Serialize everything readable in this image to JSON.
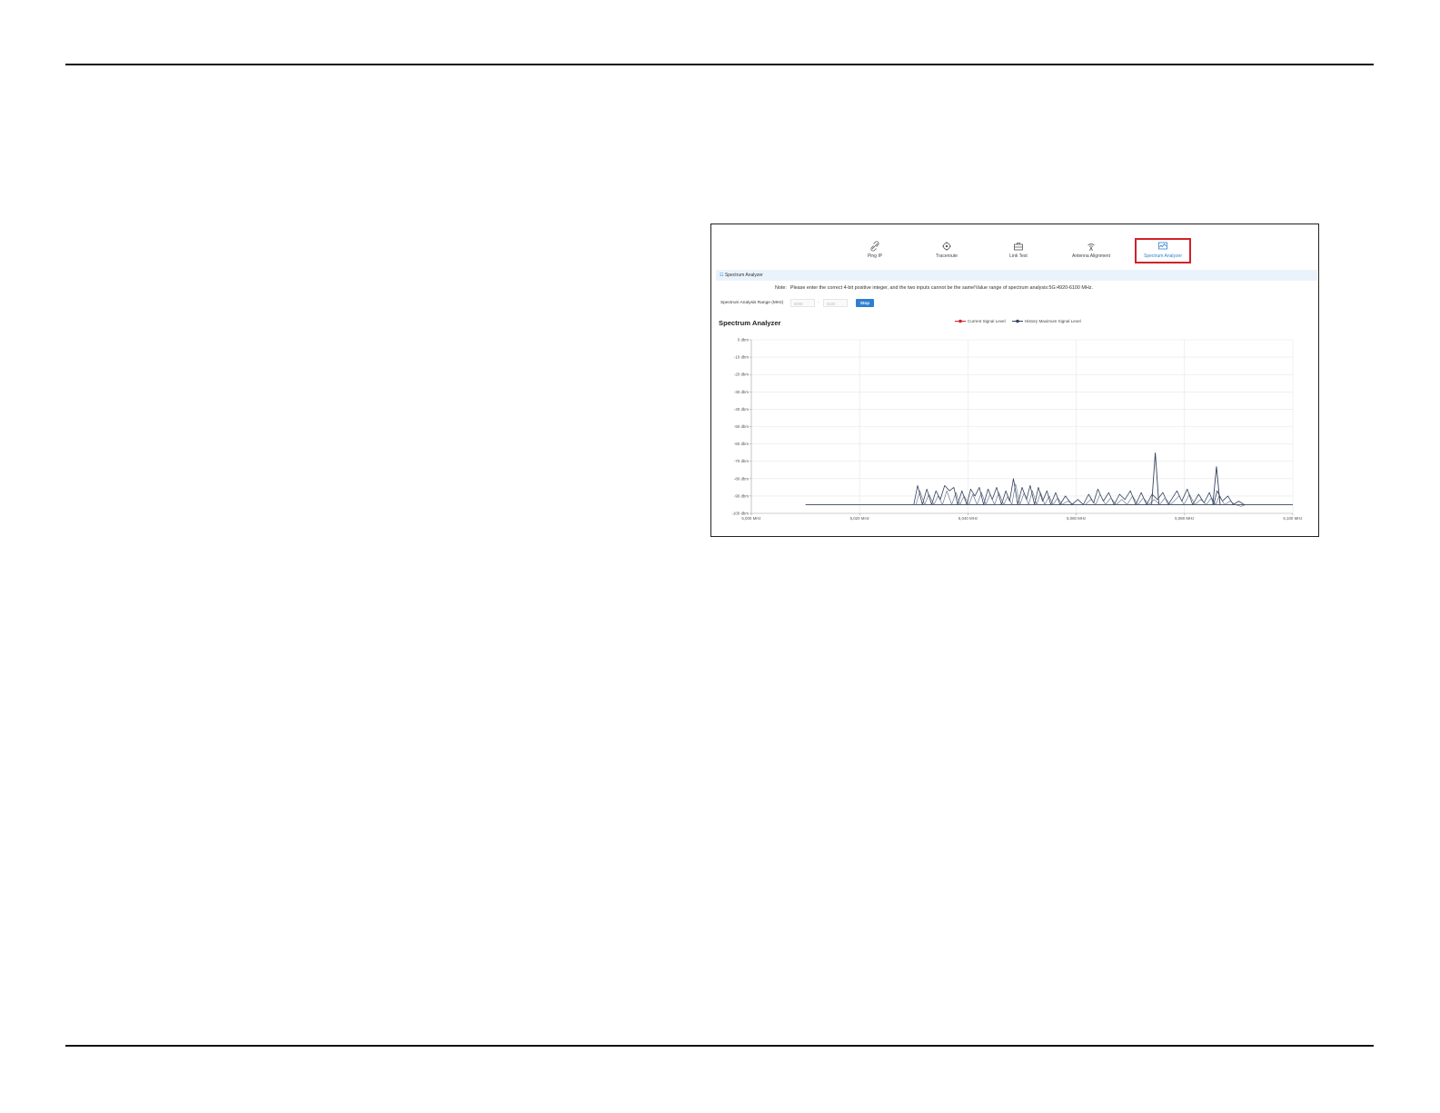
{
  "nav": {
    "items": [
      {
        "label": "Ping IP",
        "icon": "link-icon"
      },
      {
        "label": "Traceroute",
        "icon": "target-icon"
      },
      {
        "label": "Link Test",
        "icon": "toolbox-icon"
      },
      {
        "label": "Antenna Alignment",
        "icon": "antenna-icon"
      },
      {
        "label": "Spectrum Analyzer",
        "icon": "spectrum-icon",
        "active": true
      }
    ],
    "active_color": "#2f7fd1",
    "highlight_color": "#d0222a"
  },
  "section": {
    "title": "Spectrum Analyzer"
  },
  "note": {
    "label": "Note:",
    "text": "Please enter the correct 4-bit positive integer, and the two inputs cannot be the same!Value range of spectrum analysis:5G:4920-6100 MHz."
  },
  "range": {
    "label": "Spectrum Analysis Range (MHz)",
    "start_placeholder": "5000",
    "end_placeholder": "5100",
    "separator": "-",
    "stop_label": "Stop"
  },
  "chart_data": {
    "type": "line",
    "title": "Spectrum Analyzer",
    "legend_position": "top-center",
    "series": [
      {
        "name": "Current Signal Level",
        "color": "#d0222a"
      },
      {
        "name": "History Maximum Signal Level",
        "color": "#34435e"
      }
    ],
    "x_unit": "MHz",
    "xlim": [
      5000,
      5100
    ],
    "x_ticks": [
      "5,000 MHz",
      "5,020 MHz",
      "5,040 MHz",
      "5,060 MHz",
      "5,080 MHz",
      "5,100 MHz"
    ],
    "ylim": [
      -100,
      0
    ],
    "y_ticks": [
      "0 dbm",
      "-10 dbm",
      "-20 dbm",
      "-30 dbm",
      "-40 dbm",
      "-50 dbm",
      "-60 dbm",
      "-70 dbm",
      "-80 dbm",
      "-90 dbm",
      "-100 dbm"
    ],
    "grid": true,
    "floor_level": -95,
    "floor_range": [
      5010,
      5100
    ],
    "history_peaks": [
      [
        5030,
        -95
      ],
      [
        5030.7,
        -84
      ],
      [
        5031.6,
        -95
      ],
      [
        5032.4,
        -86
      ],
      [
        5033.3,
        -95
      ],
      [
        5034.1,
        -87
      ],
      [
        5034.9,
        -92
      ],
      [
        5035.7,
        -84
      ],
      [
        5036.6,
        -87
      ],
      [
        5037.4,
        -85
      ],
      [
        5038.1,
        -95
      ],
      [
        5038.9,
        -87
      ],
      [
        5039.8,
        -95
      ],
      [
        5040.5,
        -86
      ],
      [
        5041.3,
        -90
      ],
      [
        5042.1,
        -85
      ],
      [
        5042.9,
        -95
      ],
      [
        5043.7,
        -86
      ],
      [
        5044.5,
        -92
      ],
      [
        5045.3,
        -85
      ],
      [
        5046.2,
        -95
      ],
      [
        5047,
        -87
      ],
      [
        5047.7,
        -93
      ],
      [
        5048.4,
        -80
      ],
      [
        5049.2,
        -95
      ],
      [
        5050,
        -85
      ],
      [
        5050.8,
        -92
      ],
      [
        5051.5,
        -84
      ],
      [
        5052.3,
        -95
      ],
      [
        5053,
        -85
      ],
      [
        5053.8,
        -93
      ],
      [
        5054.6,
        -87
      ],
      [
        5055.3,
        -95
      ],
      [
        5056.2,
        -88
      ],
      [
        5057,
        -95
      ],
      [
        5058,
        -90
      ],
      [
        5059.2,
        -95
      ],
      [
        5060.3,
        -92
      ],
      [
        5061.3,
        -95
      ],
      [
        5062.3,
        -89
      ],
      [
        5063.2,
        -94
      ],
      [
        5064,
        -86
      ],
      [
        5065,
        -93
      ],
      [
        5066,
        -88
      ],
      [
        5067,
        -95
      ],
      [
        5068,
        -89
      ],
      [
        5069,
        -92
      ],
      [
        5070,
        -87
      ],
      [
        5071,
        -95
      ],
      [
        5072,
        -88
      ],
      [
        5073,
        -95
      ],
      [
        5074,
        -89
      ],
      [
        5075,
        -92
      ],
      [
        5076,
        -88
      ],
      [
        5077,
        -95
      ],
      [
        5078.6,
        -87
      ],
      [
        5079.5,
        -93
      ],
      [
        5080.5,
        -86
      ],
      [
        5081.5,
        -95
      ],
      [
        5082.6,
        -89
      ],
      [
        5083.6,
        -94
      ],
      [
        5084.6,
        -88
      ],
      [
        5085.4,
        -95
      ],
      [
        5086,
        -87
      ],
      [
        5087,
        -93
      ],
      [
        5088,
        -90
      ],
      [
        5089,
        -95
      ],
      [
        5090,
        -93
      ],
      [
        5091,
        -95
      ]
    ],
    "history_spikes": [
      [
        5074.6,
        -65
      ],
      [
        5085.9,
        -73
      ]
    ]
  }
}
